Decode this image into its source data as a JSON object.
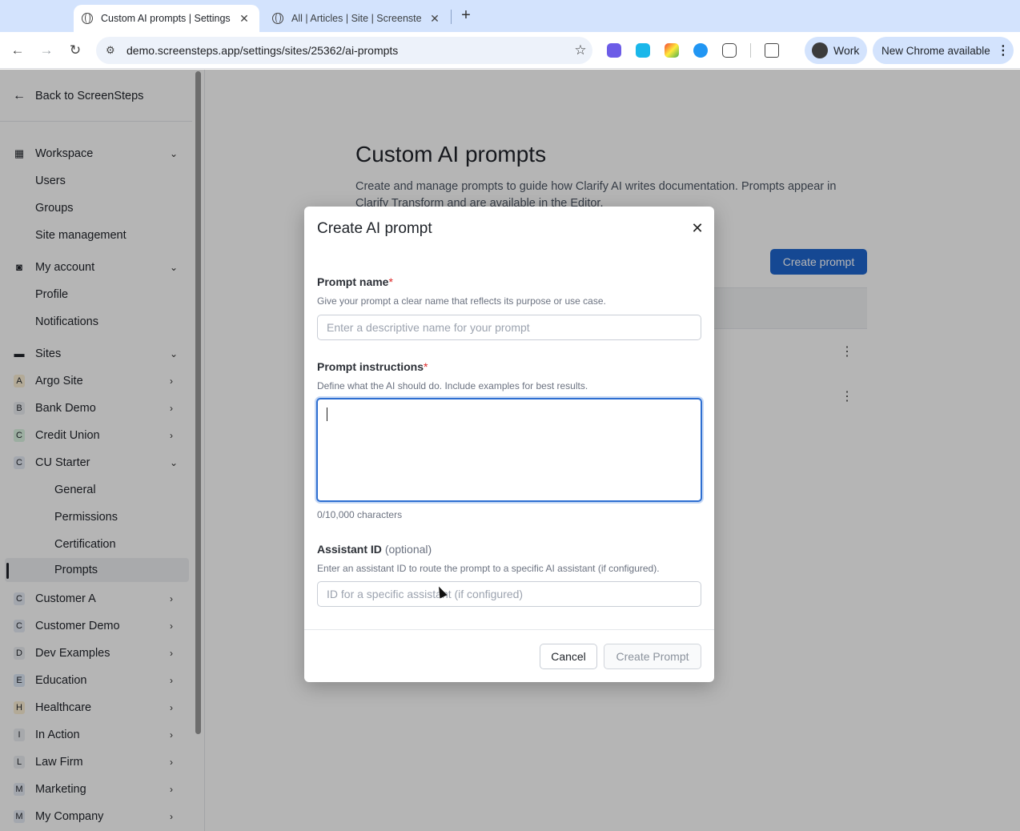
{
  "browser": {
    "tabs": [
      {
        "title": "Custom AI prompts | Settings",
        "active": true
      },
      {
        "title": "All | Articles | Site | Screenste",
        "active": false
      }
    ],
    "url": "demo.screensteps.app/settings/sites/25362/ai-prompts",
    "profile_label": "Work",
    "update_label": "New Chrome available"
  },
  "sidebar": {
    "back_label": "Back to ScreenSteps",
    "sections": {
      "workspace": {
        "label": "Workspace",
        "items": [
          "Users",
          "Groups",
          "Site management"
        ]
      },
      "account": {
        "label": "My account",
        "items": [
          "Profile",
          "Notifications"
        ]
      },
      "sites": {
        "label": "Sites"
      }
    },
    "sites": [
      {
        "letter": "A",
        "label": "Argo Site"
      },
      {
        "letter": "B",
        "label": "Bank Demo"
      },
      {
        "letter": "C",
        "label": "Credit Union"
      },
      {
        "letter": "C",
        "label": "CU Starter"
      },
      {
        "letter": "C",
        "label": "Customer A"
      },
      {
        "letter": "C",
        "label": "Customer Demo"
      },
      {
        "letter": "D",
        "label": "Dev Examples"
      },
      {
        "letter": "E",
        "label": "Education"
      },
      {
        "letter": "H",
        "label": "Healthcare"
      },
      {
        "letter": "I",
        "label": "In Action"
      },
      {
        "letter": "L",
        "label": "Law Firm"
      },
      {
        "letter": "M",
        "label": "Marketing"
      },
      {
        "letter": "M",
        "label": "My Company"
      }
    ],
    "cu_starter_items": [
      "General",
      "Permissions",
      "Certification",
      "Prompts"
    ]
  },
  "page": {
    "title": "Custom AI prompts",
    "description": "Create and manage prompts to guide how Clarify AI writes documentation. Prompts appear in Clarify Transform and are available in the Editor.",
    "create_button": "Create prompt"
  },
  "modal": {
    "title": "Create AI prompt",
    "name_label": "Prompt name",
    "name_hint": "Give your prompt a clear name that reflects its purpose or use case.",
    "name_placeholder": "Enter a descriptive name for your prompt",
    "instructions_label": "Prompt instructions",
    "instructions_hint": "Define what the AI should do. Include examples for best results.",
    "instructions_value": "",
    "counter": "0/10,000 characters",
    "assistant_label": "Assistant ID",
    "assistant_optional": "(optional)",
    "assistant_hint": "Enter an assistant ID to route the prompt to a specific AI assistant (if configured).",
    "assistant_placeholder": "ID for a specific assistant (if configured)",
    "required_marker": "*",
    "cancel_label": "Cancel",
    "submit_label": "Create Prompt"
  },
  "colors": {
    "primary": "#1e66d0",
    "required": "#dc2626",
    "focus_border": "#2e6fd1"
  }
}
